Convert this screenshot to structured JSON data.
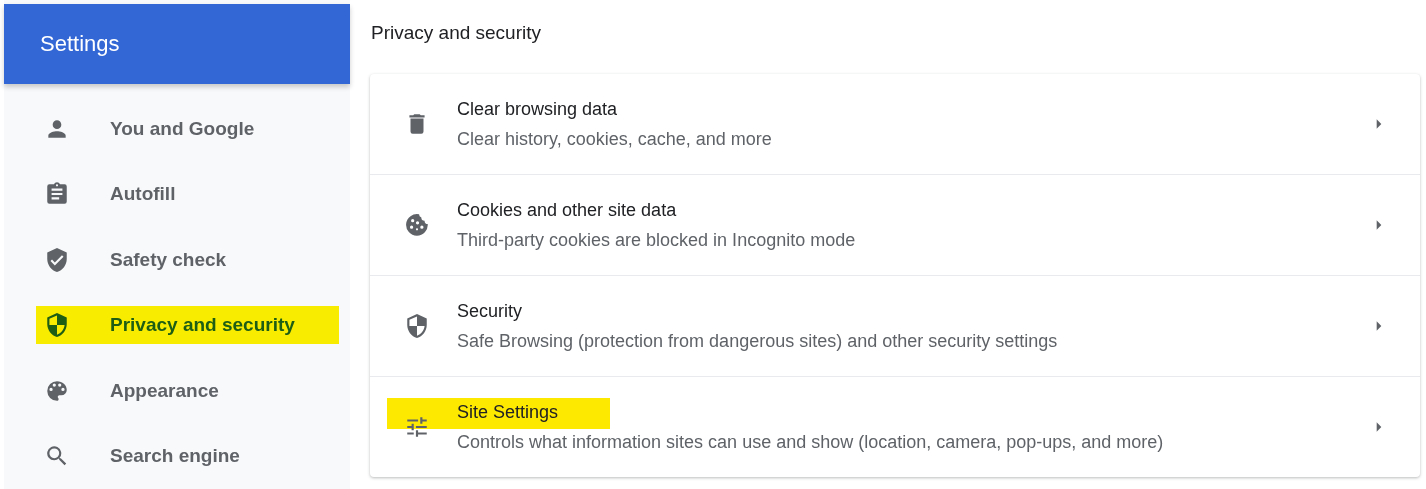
{
  "header": {
    "title": "Settings"
  },
  "sidebar": {
    "items": [
      {
        "label": "You and Google",
        "kind": "person",
        "selected": false,
        "highlighted": false
      },
      {
        "label": "Autofill",
        "kind": "clipboard",
        "selected": false,
        "highlighted": false
      },
      {
        "label": "Safety check",
        "kind": "shield-check",
        "selected": false,
        "highlighted": false
      },
      {
        "label": "Privacy and security",
        "kind": "shield-half",
        "selected": true,
        "highlighted": true
      },
      {
        "label": "Appearance",
        "kind": "palette",
        "selected": false,
        "highlighted": false
      },
      {
        "label": "Search engine",
        "kind": "search",
        "selected": false,
        "highlighted": false
      }
    ]
  },
  "section": {
    "title": "Privacy and security",
    "rows": [
      {
        "kind": "trash",
        "title": "Clear browsing data",
        "subtitle": "Clear history, cookies, cache, and more",
        "highlighted": false
      },
      {
        "kind": "cookie",
        "title": "Cookies and other site data",
        "subtitle": "Third-party cookies are blocked in Incognito mode",
        "highlighted": false
      },
      {
        "kind": "shield-half",
        "title": "Security",
        "subtitle": "Safe Browsing (protection from dangerous sites) and other security settings",
        "highlighted": false
      },
      {
        "kind": "sliders",
        "title": "Site Settings",
        "subtitle": "Controls what information sites can use and show (location, camera, pop-ups, and more)",
        "highlighted": true
      }
    ]
  }
}
